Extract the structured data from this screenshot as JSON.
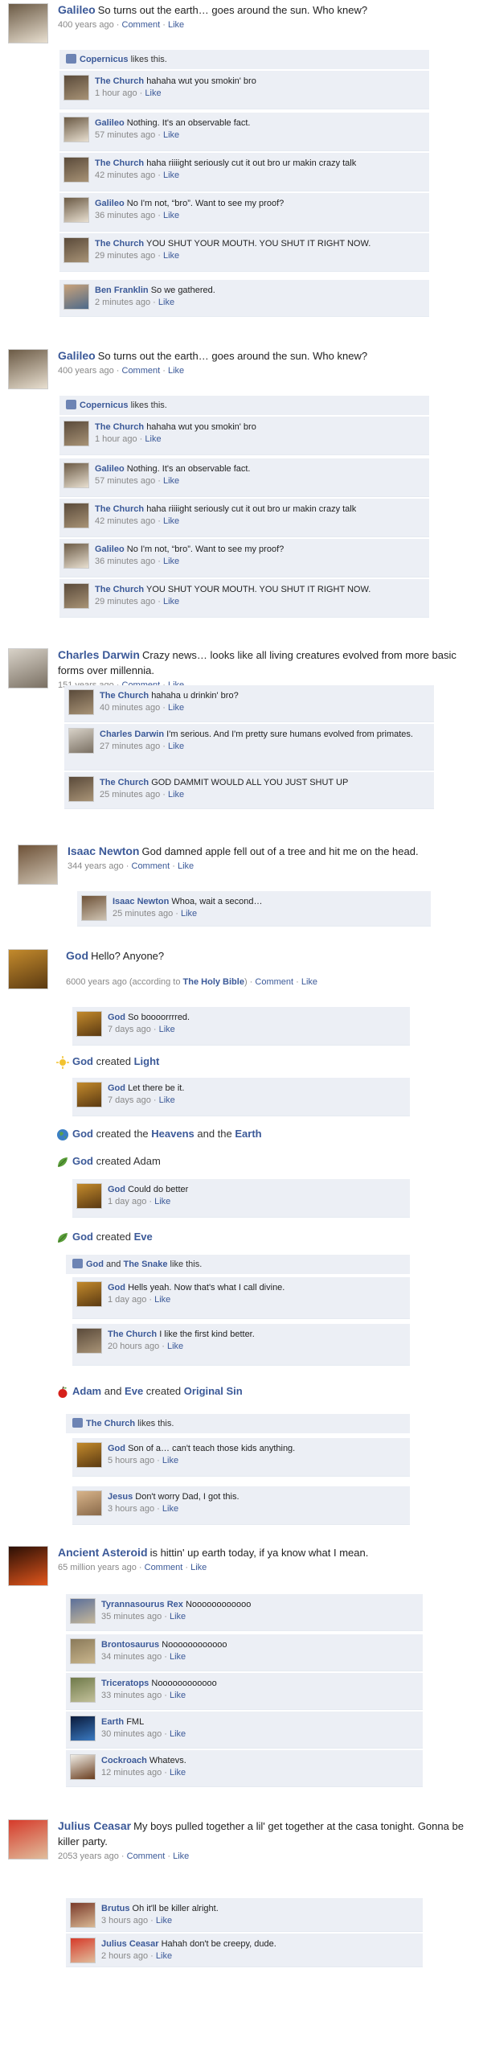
{
  "sep": "·",
  "posts": [
    {
      "author": "Galileo",
      "text": "So turns out the earth… goes around the sun.  Who knew?",
      "time": "400 years ago",
      "comment": "Comment",
      "like": "Like",
      "likes": {
        "who": "Copernicus",
        "rest": "likes this."
      },
      "comments": [
        {
          "n": "The Church",
          "t": "hahaha wut you smokin' bro",
          "time": "1 hour ago",
          "like": "Like"
        },
        {
          "n": "Galileo",
          "t": "Nothing.  It's an observable fact.",
          "time": "57 minutes ago",
          "like": "Like"
        },
        {
          "n": "The Church",
          "t": "haha riiiight seriously cut it out bro ur makin crazy talk",
          "time": "42 minutes ago",
          "like": "Like"
        },
        {
          "n": "Galileo",
          "t": "No I'm not, “bro”.  Want to see my proof?",
          "time": "36 minutes ago",
          "like": "Like"
        },
        {
          "n": "The Church",
          "t": "YOU SHUT YOUR MOUTH.  YOU SHUT IT RIGHT NOW.",
          "time": "29 minutes ago",
          "like": "Like"
        }
      ],
      "extra": {
        "n": "Ben Franklin",
        "t": "So we gathered.",
        "time": "2 minutes ago",
        "like": "Like"
      }
    },
    {
      "author": "Galileo",
      "text": "So turns out the earth… goes around the sun.  Who knew?",
      "time": "400 years ago",
      "comment": "Comment",
      "like": "Like",
      "likes": {
        "who": "Copernicus",
        "rest": "likes this."
      },
      "comments": [
        {
          "n": "The Church",
          "t": "hahaha wut you smokin' bro",
          "time": "1 hour ago",
          "like": "Like"
        },
        {
          "n": "Galileo",
          "t": "Nothing.  It's an observable fact.",
          "time": "57 minutes ago",
          "like": "Like"
        },
        {
          "n": "The Church",
          "t": "haha riiiight seriously cut it out bro ur makin crazy talk",
          "time": "42 minutes ago",
          "like": "Like"
        },
        {
          "n": "Galileo",
          "t": "No I'm not, “bro”.  Want to see my proof?",
          "time": "36 minutes ago",
          "like": "Like"
        },
        {
          "n": "The Church",
          "t": "YOU SHUT YOUR MOUTH.  YOU SHUT IT RIGHT NOW.",
          "time": "29 minutes ago",
          "like": "Like"
        }
      ]
    },
    {
      "author": "Charles Darwin",
      "text": "Crazy news… looks like all living creatures evolved from more basic forms over millennia.",
      "time": "151 years ago",
      "comment": "Comment",
      "like": "Like",
      "comments": [
        {
          "n": "The Church",
          "t": " hahaha u drinkin' bro?",
          "time": "40 minutes ago",
          "like": "Like"
        },
        {
          "n": "Charles Darwin",
          "t": "I'm serious.  And I'm pretty sure humans evolved from primates.",
          "time": "27 minutes ago",
          "like": "Like"
        },
        {
          "n": "The Church",
          "t": "GOD DAMMIT WOULD ALL YOU JUST SHUT UP",
          "time": "25 minutes ago",
          "like": "Like"
        }
      ]
    },
    {
      "author": "Isaac Newton",
      "text": "God damned apple fell out of a tree and hit me on the head.",
      "time": "344 years ago",
      "comment": "Comment",
      "like": "Like",
      "comments": [
        {
          "n": "Isaac Newton",
          "t": "Whoa, wait a second…",
          "time": "25 minutes ago",
          "like": "Like"
        }
      ]
    }
  ],
  "god": {
    "author": "God",
    "text": "Hello?  Anyone?",
    "time": "6000 years ago (according to ",
    "bible": "The Holy Bible",
    "time_end": ")",
    "comment": "Comment",
    "like": "Like",
    "items": [
      {
        "kind": "c",
        "n": "God",
        "t": "So boooorrrred.",
        "time": "7 days ago",
        "like": "Like"
      },
      {
        "kind": "e",
        "icon": "sun",
        "parts": [
          [
            "n",
            "God"
          ],
          [
            "t",
            " created "
          ],
          [
            "n",
            "Light"
          ]
        ]
      },
      {
        "kind": "c",
        "n": "God",
        "t": "Let there be it.",
        "time": "7 days ago",
        "like": "Like"
      },
      {
        "kind": "e",
        "icon": "globe",
        "parts": [
          [
            "n",
            "God"
          ],
          [
            "t",
            " created the "
          ],
          [
            "n",
            "Heavens"
          ],
          [
            "t",
            " and the "
          ],
          [
            "n",
            "Earth"
          ]
        ]
      },
      {
        "kind": "e",
        "icon": "leaf",
        "parts": [
          [
            "n",
            "God"
          ],
          [
            "t",
            " created Adam"
          ]
        ]
      },
      {
        "kind": "c",
        "n": "God",
        "t": "Could do better",
        "time": "1 day ago",
        "like": "Like"
      },
      {
        "kind": "e",
        "icon": "leaf",
        "parts": [
          [
            "n",
            "God"
          ],
          [
            "t",
            " created "
          ],
          [
            "n",
            "Eve"
          ]
        ]
      },
      {
        "kind": "l",
        "parts": [
          [
            "n",
            "God"
          ],
          [
            "t",
            " and "
          ],
          [
            "n",
            "The Snake"
          ],
          [
            "t",
            " like this."
          ]
        ]
      },
      {
        "kind": "c",
        "n": "God",
        "t": "Hells yeah.  Now that's what I call divine.",
        "time": "1 day ago",
        "like": "Like"
      },
      {
        "kind": "c",
        "n": "The Church",
        "t": "I like the first kind better.",
        "time": "20 hours ago",
        "like": "Like"
      },
      {
        "kind": "e",
        "icon": "apple",
        "parts": [
          [
            "n",
            "Adam"
          ],
          [
            "t",
            " and "
          ],
          [
            "n",
            "Eve"
          ],
          [
            "t",
            " created "
          ],
          [
            "n",
            "Original Sin"
          ]
        ]
      },
      {
        "kind": "l",
        "parts": [
          [
            "n",
            "The Church"
          ],
          [
            "t",
            " likes this."
          ]
        ]
      },
      {
        "kind": "c",
        "n": "God",
        "t": "Son of a… can't teach those kids anything.",
        "time": "5 hours ago",
        "like": "Like"
      },
      {
        "kind": "c",
        "n": "Jesus",
        "t": "Don't worry Dad, I got this.",
        "time": "3 hours ago",
        "like": "Like"
      }
    ]
  },
  "asteroid": {
    "author": "Ancient Asteroid",
    "text": "is hittin' up earth today, if ya know what I mean.",
    "time": "65 million years ago",
    "comment": "Comment",
    "like": "Like",
    "comments": [
      {
        "n": "Tyrannasourus Rex",
        "t": "Noooooooooooo",
        "time": "35 minutes ago",
        "like": "Like"
      },
      {
        "n": "Brontosaurus",
        "t": "Noooooooooooo",
        "time": "34 minutes ago",
        "like": "Like"
      },
      {
        "n": "Triceratops",
        "t": "Noooooooooooo",
        "time": "33 minutes ago",
        "like": "Like"
      },
      {
        "n": "Earth",
        "t": "FML",
        "time": "30 minutes ago",
        "like": "Like"
      },
      {
        "n": "Cockroach",
        "t": "Whatevs.",
        "time": "12 minutes ago",
        "like": "Like"
      }
    ]
  },
  "caesar": {
    "author": "Julius Ceasar",
    "text": "My boys pulled together a lil' get together at the casa tonight.  Gonna be killer party.",
    "time": "2053 years ago",
    "comment": "Comment",
    "like": "Like",
    "comments": [
      {
        "n": "Brutus",
        "t": "Oh it'll be killer alright.",
        "time": "3 hours ago",
        "like": "Like"
      },
      {
        "n": "Julius Ceasar",
        "t": "Hahah don't be creepy, dude.",
        "time": "2 hours ago",
        "like": "Like"
      }
    ]
  },
  "colors": {
    "link": "#3b5998",
    "comment_bg": "#eceff5",
    "meta": "#888888"
  }
}
